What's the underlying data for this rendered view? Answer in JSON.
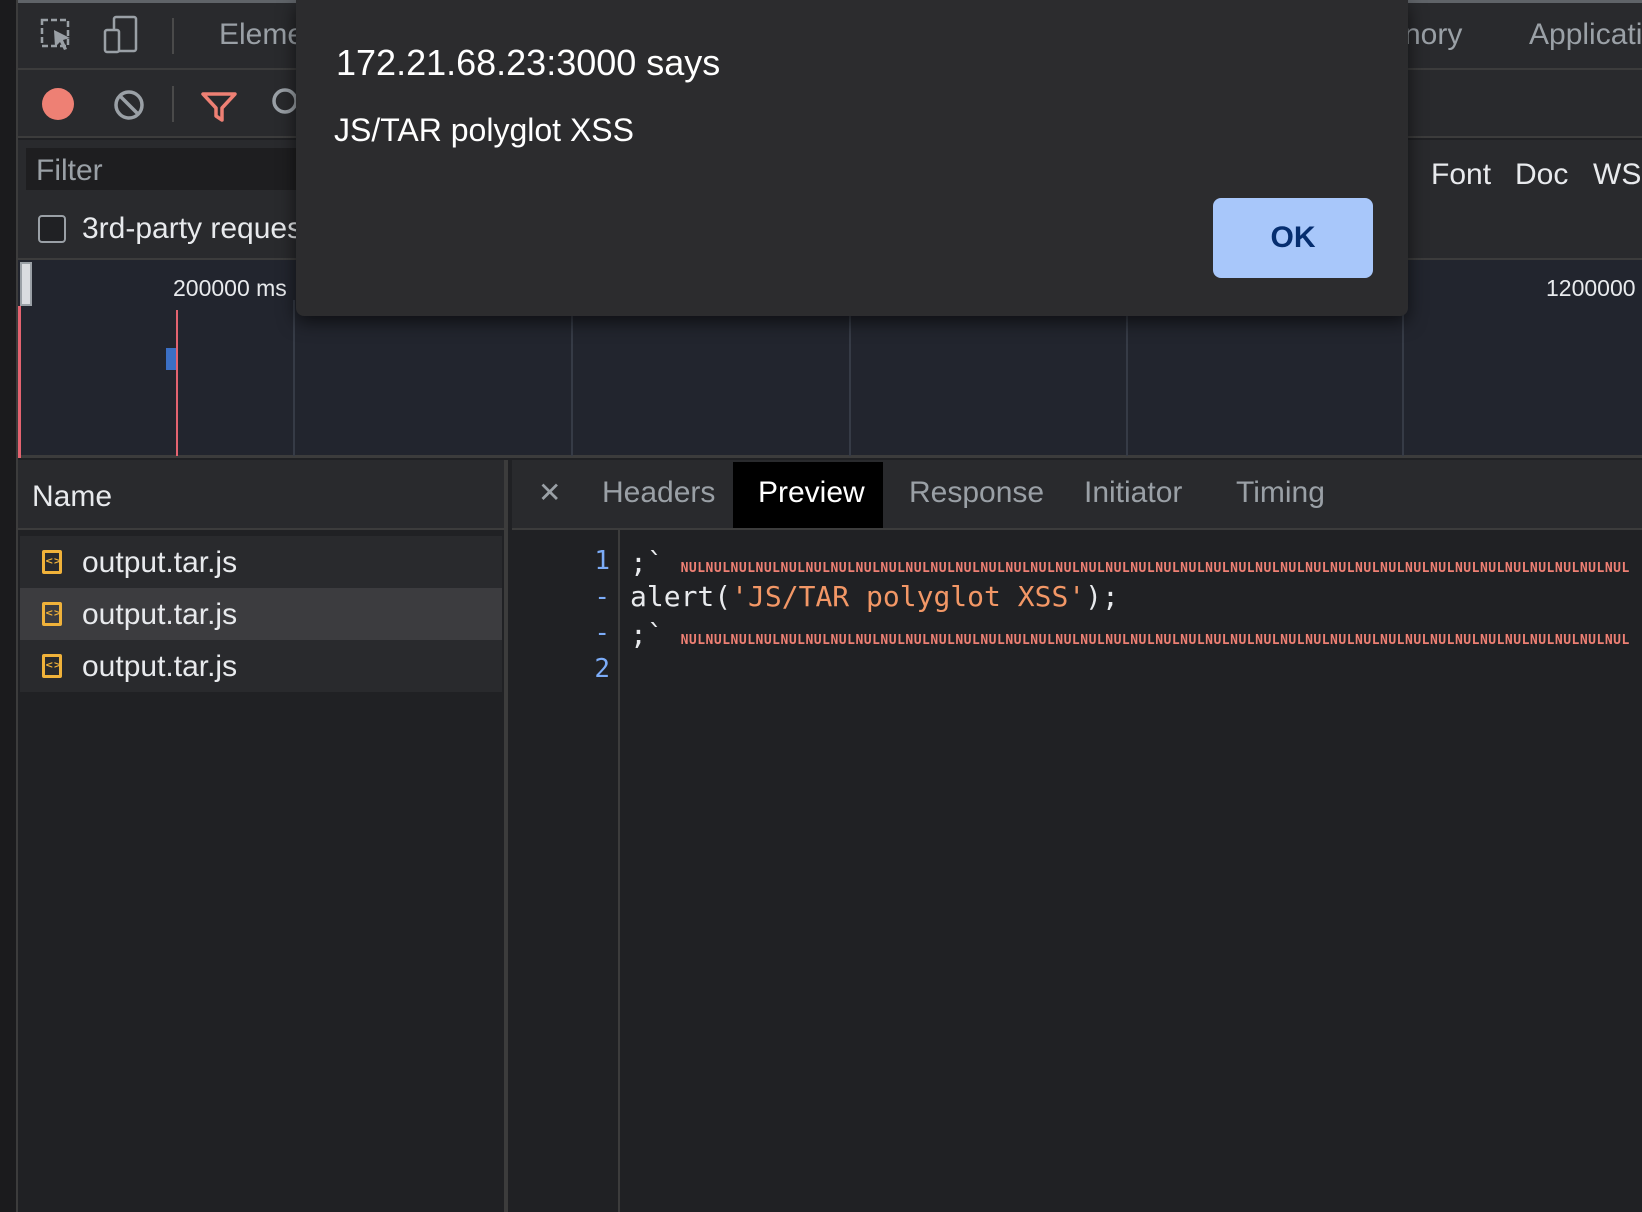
{
  "tabs": {
    "elements": "Eleme",
    "memory": "nory",
    "application": "Applicati"
  },
  "filter": {
    "placeholder": "Filter",
    "third_party_label": "3rd-party reques",
    "types": [
      "Font",
      "Doc",
      "WS"
    ]
  },
  "overview": {
    "label_left": "200000 ms",
    "label_right": "1200000"
  },
  "requests": {
    "header": "Name",
    "rows": [
      "output.tar.js",
      "output.tar.js",
      "output.tar.js"
    ],
    "selected_index": 1
  },
  "detail": {
    "tabs": [
      "Headers",
      "Preview",
      "Response",
      "Initiator",
      "Timing"
    ],
    "active_tab": "Preview",
    "line_numbers": [
      "1",
      "-",
      "-",
      "2"
    ],
    "code": {
      "line1_prefix": ";`",
      "line2_fn": "alert(",
      "line2_str": "'JS/TAR polyglot XSS'",
      "line2_end": ");",
      "line3_prefix": ";`",
      "nul_run": "NULNULNULNULNULNULNULNULNULNULNULNULNULNULNULNULNULNULNULNULNULNULNULNULNULNULNULNULNULNULNULNULNULNULNULNULNULNULNULNULNULNULNULNULNUL"
    }
  },
  "dialog": {
    "title": "172.21.68.23:3000 says",
    "message": "JS/TAR polyglot XSS",
    "ok_label": "OK"
  },
  "colors": {
    "accent": "#a8c7fa",
    "record": "#ee8074",
    "file_icon": "#f0b23a"
  }
}
